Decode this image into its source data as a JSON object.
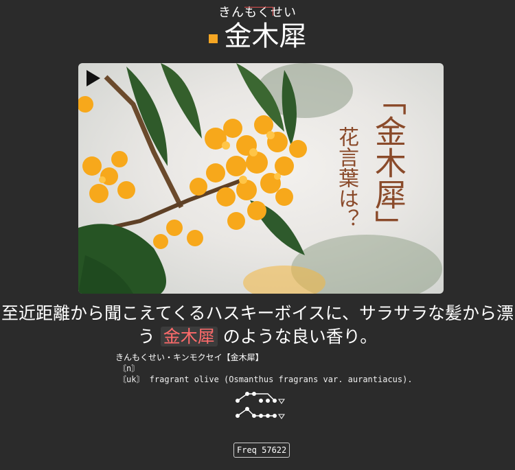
{
  "header": {
    "reading": "きんもくせい",
    "title": "金木犀"
  },
  "image": {
    "caption_main": "「金木犀」",
    "caption_sub": "花言葉は？"
  },
  "sentence": {
    "before": "至近距離から聞こえてくるハスキーボイスに、サラサラな髪から漂う",
    "highlight": "金木犀",
    "after": "のような良い香り。"
  },
  "definition": {
    "line1": "きんもくせい・キンモクセイ【金木犀】",
    "line2": "〘n〙",
    "line3": "〘uk〙 fragrant olive (Osmanthus fragrans var. aurantiacus)."
  },
  "freq": "Freq 57622",
  "colors": {
    "accent": "#f5a623",
    "highlight": "#ff6b6b",
    "background": "#2b2b2b",
    "flower": "#f7a81b",
    "leaf": "#2f5a2a"
  }
}
